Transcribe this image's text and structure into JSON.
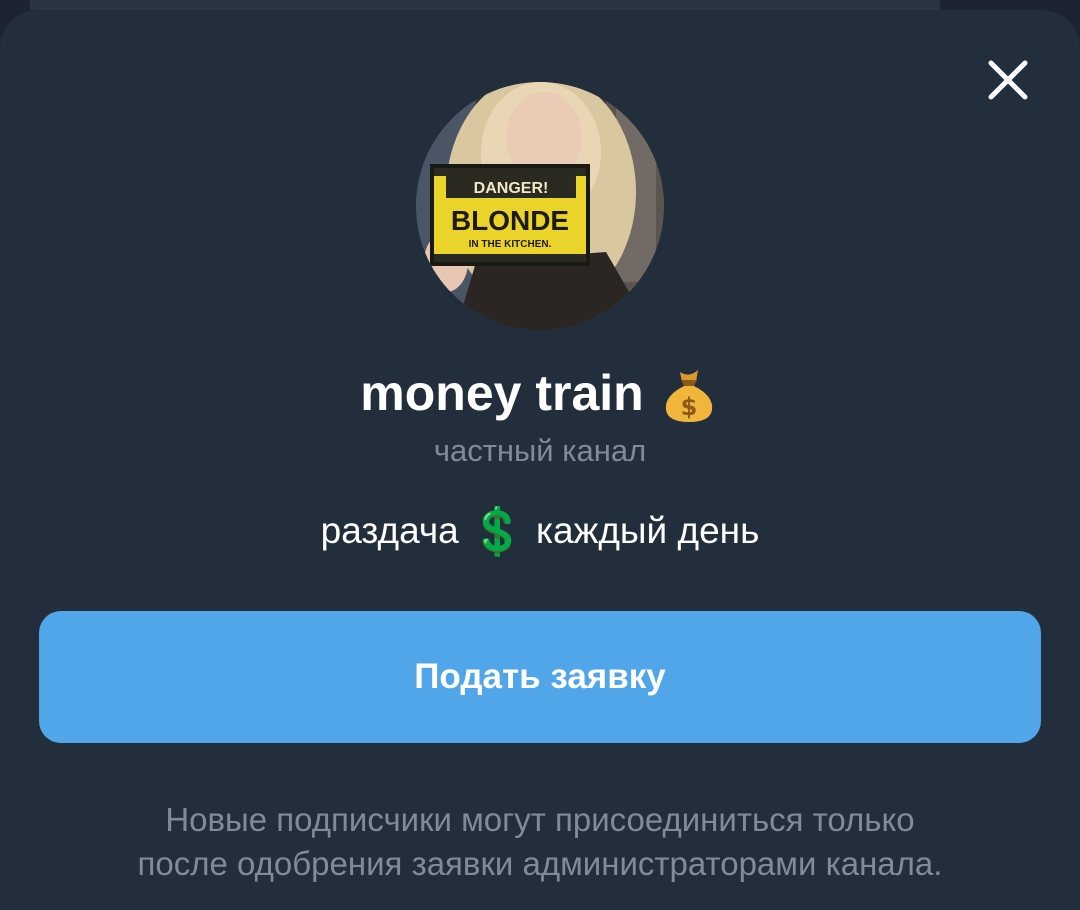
{
  "channel": {
    "title": "money train",
    "title_emoji_icon": "money-bag-icon",
    "type_label": "частный канал",
    "description_before": "раздача",
    "description_emoji_icon": "heavy-dollar-sign-icon",
    "description_emoji": "💲",
    "description_after": "каждый день",
    "avatar_sign": {
      "line1": "DANGER!",
      "line2": "BLONDE",
      "line3": "IN THE KITCHEN."
    }
  },
  "actions": {
    "join_label": "Подать заявку",
    "close_icon": "close-icon"
  },
  "note": {
    "line1": "Новые подписчики могут присоединиться только",
    "line2": "после одобрения заявки администраторами канала."
  },
  "colors": {
    "background": "#1b2430",
    "sheet": "#222e3c",
    "accent": "#50a6e8",
    "text_primary": "#ffffff",
    "text_secondary": "#7f8b99"
  }
}
